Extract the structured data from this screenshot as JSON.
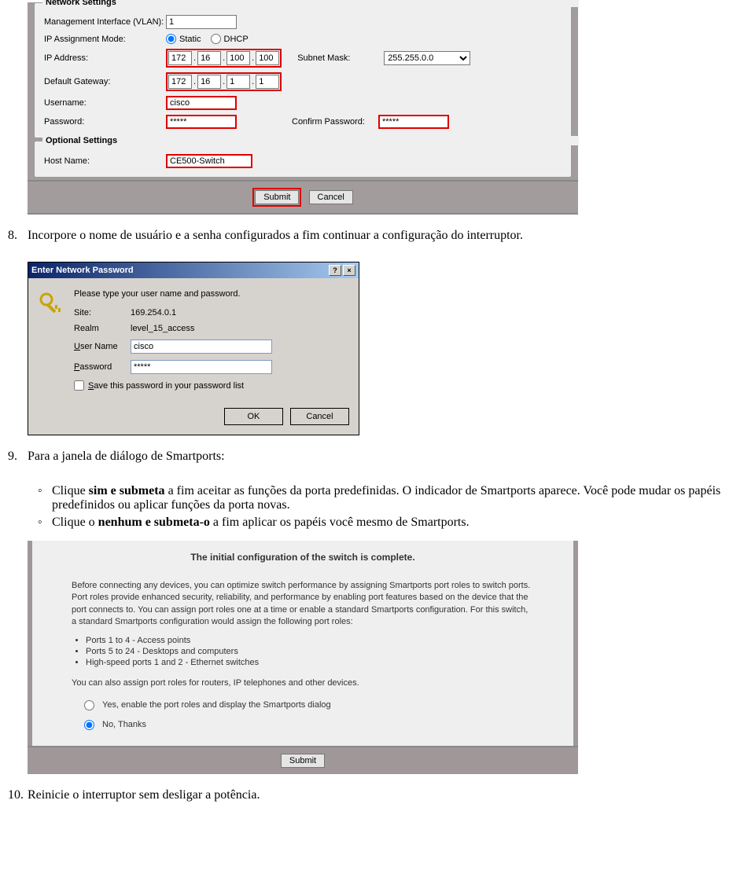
{
  "doc": {
    "item8_num": "8.",
    "item8_text": "Incorpore o nome de usuário e a senha configurados a fim continuar a configuração do interruptor.",
    "item9_num": "9.",
    "item9_text": "Para a janela de diálogo de Smartports:",
    "item9_sub1": "Clique sim e submeta a fim aceitar as funções da porta predefinidas. O indicador de Smartports aparece. Você pode mudar os papéis predefinidos ou aplicar funções da porta novas.",
    "item9_sub2": "Clique o nenhum e submeta-o a fim aplicar os papéis você mesmo de Smartports.",
    "item9_sub1_bold": "sim e submeta",
    "item9_sub2_bold": "nenhum e submeta-o",
    "item10_num": "10.",
    "item10_text": "Reinicie o interruptor sem desligar a potência."
  },
  "form1": {
    "legend1": "Network Settings",
    "legend2": "Optional Settings",
    "labels": {
      "vlan": "Management Interface (VLAN):",
      "ipmode": "IP Assignment Mode:",
      "ipaddr": "IP Address:",
      "subnet": "Subnet Mask:",
      "gateway": "Default Gateway:",
      "username": "Username:",
      "password": "Password:",
      "confirm": "Confirm Password:",
      "hostname": "Host Name:"
    },
    "values": {
      "vlan": "1",
      "static": "Static",
      "dhcp": "DHCP",
      "ip": [
        "172",
        "16",
        "100",
        "100"
      ],
      "subnet": "255.255.0.0",
      "gw": [
        "172",
        "16",
        "1",
        "1"
      ],
      "username": "cisco",
      "password": "*****",
      "confirm": "*****",
      "hostname": "CE500-Switch"
    },
    "buttons": {
      "submit": "Submit",
      "cancel": "Cancel"
    }
  },
  "dialog": {
    "title": "Enter Network Password",
    "prompt": "Please type your user name and password.",
    "site_lbl": "Site:",
    "site": "169.254.0.1",
    "realm_lbl": "Realm",
    "realm": "level_15_access",
    "user_lbl": "User Name",
    "user": "cisco",
    "pass_lbl": "Password",
    "pass": "*****",
    "save": "Save this password in your password list",
    "ok": "OK",
    "cancel": "Cancel"
  },
  "smartports": {
    "title": "The initial configuration of the switch is complete.",
    "para1": "Before connecting any devices, you can optimize switch performance by assigning Smartports port roles to switch ports. Port roles provide enhanced security, reliability, and performance by enabling port features based on the device that the port connects to. You can assign port roles one at a time or enable a standard Smartports configuration. For this switch, a standard Smartports configuration would assign the following port roles:",
    "list": [
      "Ports 1 to 4 - Access points",
      "Ports 5 to 24 - Desktops and computers",
      "High-speed ports 1 and 2 - Ethernet switches"
    ],
    "para2": "You can also assign port roles for routers, IP telephones and other devices.",
    "opt_yes": "Yes, enable the port roles and display the Smartports dialog",
    "opt_no": "No, Thanks",
    "submit": "Submit"
  }
}
